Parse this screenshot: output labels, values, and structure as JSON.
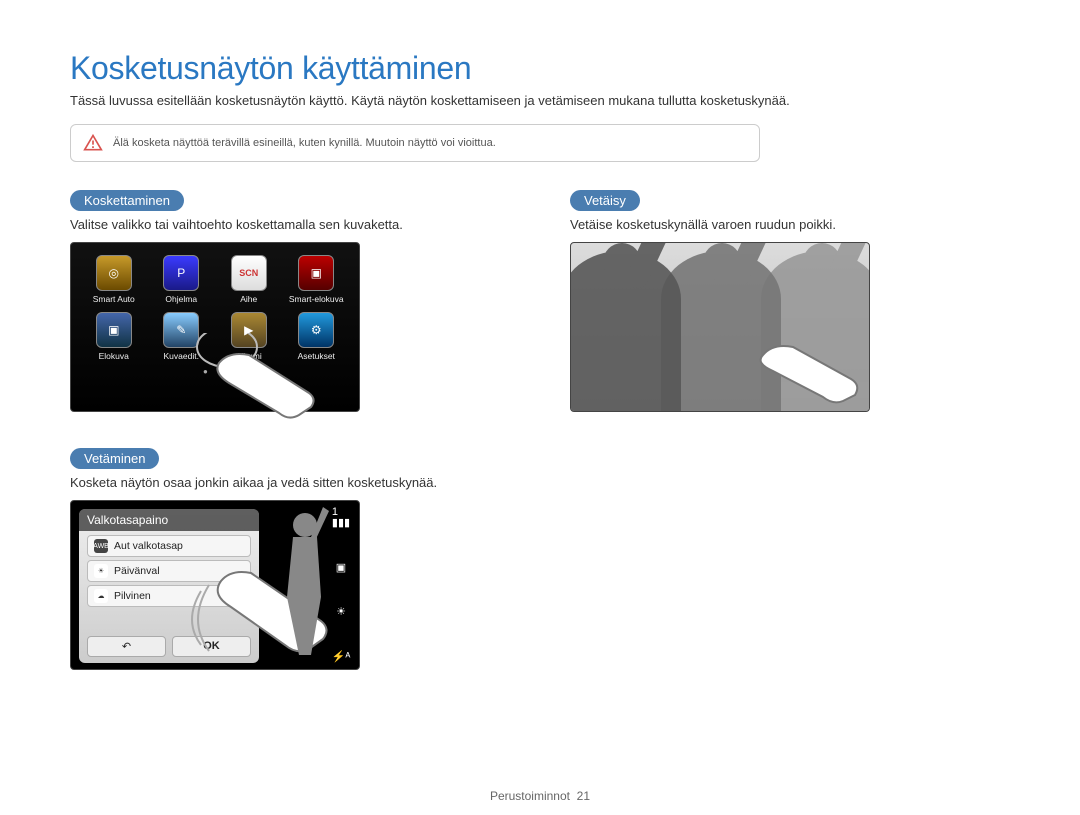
{
  "page": {
    "title": "Kosketusnäytön käyttäminen",
    "intro": "Tässä luvussa esitellään kosketusnäytön käyttö. Käytä näytön koskettamiseen ja vetämiseen mukana tullutta kosketuskynää.",
    "warning": "Älä kosketa näyttöä terävillä esineillä, kuten kynillä. Muutoin näyttö voi vioittua."
  },
  "touching": {
    "heading": "Koskettaminen",
    "desc": "Valitse valikko tai vaihtoehto koskettamalla sen kuvaketta.",
    "apps": [
      {
        "label": "Smart Auto"
      },
      {
        "label": "Ohjelma"
      },
      {
        "label": "Aihe"
      },
      {
        "label": "Smart-elokuva"
      },
      {
        "label": "Elokuva"
      },
      {
        "label": "Kuvaedit."
      },
      {
        "label": "Albumi"
      },
      {
        "label": "Asetukset"
      }
    ]
  },
  "dragging": {
    "heading": "Vetäminen",
    "desc": "Kosketa näytön osaa jonkin aikaa ja vedä sitten kosketuskynää.",
    "panel_title": "Valkotasapaino",
    "items": [
      {
        "label": "Aut valkotasap"
      },
      {
        "label": "Päivänval"
      },
      {
        "label": "Pilvinen"
      }
    ],
    "back": "↶",
    "ok": "OK",
    "counter": "1"
  },
  "flicking": {
    "heading": "Vetäisy",
    "desc": "Vetäise kosketuskynällä varoen ruudun poikki."
  },
  "footer": {
    "section": "Perustoiminnot",
    "page": "21"
  }
}
